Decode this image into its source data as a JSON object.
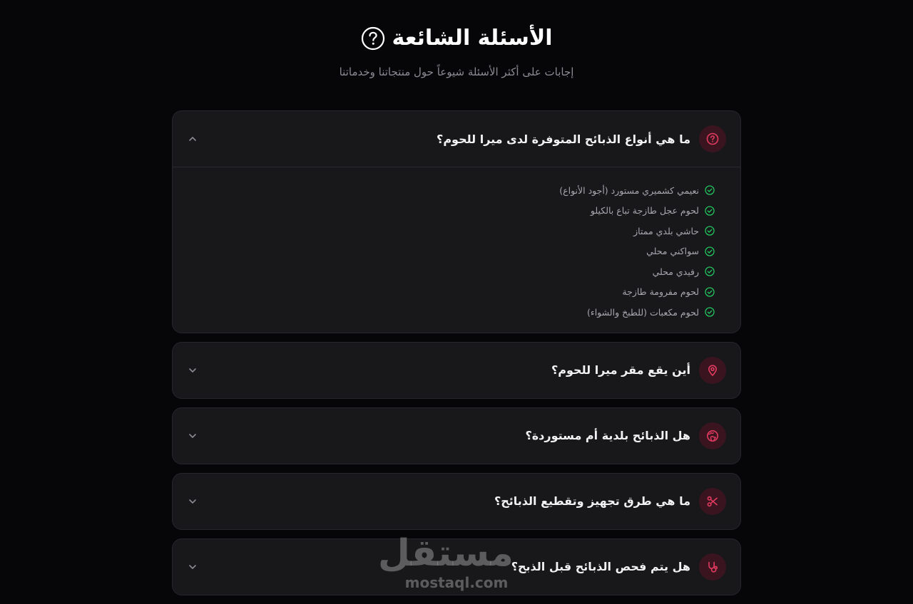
{
  "header": {
    "title": "الأسئلة الشائعة",
    "subtitle": "إجابات على أكثر الأسئلة شيوعاً حول منتجاتنا وخدماتنا"
  },
  "faq": [
    {
      "question": "ما هي أنواع الذبائح المتوفرة لدى ميرا للحوم؟",
      "icon": "question-circle-icon",
      "open": true,
      "answers": [
        "نعيمي كشميري مستورد (أجود الأنواع)",
        "لحوم عجل طازجة تباع بالكيلو",
        "حاشي بلدي ممتاز",
        "سواكني محلي",
        "رفيدي محلي",
        "لحوم مفرومة طازجة",
        "لحوم مكعبات (للطبخ والشواء)"
      ]
    },
    {
      "question": "أين يقع مقر ميرا للحوم؟",
      "icon": "map-pin-icon",
      "open": false
    },
    {
      "question": "هل الذبائح بلدية أم مستوردة؟",
      "icon": "globe-icon",
      "open": false
    },
    {
      "question": "ما هي طرق تجهيز وتقطيع الذبائح؟",
      "icon": "scissors-icon",
      "open": false
    },
    {
      "question": "هل يتم فحص الذبائح قبل الذبح؟",
      "icon": "stethoscope-icon",
      "open": false
    }
  ],
  "watermark": {
    "main": "مستقل",
    "sub": "mostaql.com"
  },
  "colors": {
    "background": "#060608",
    "card": "#18181b",
    "accent": "#e23b5f",
    "check": "#22c55e"
  }
}
